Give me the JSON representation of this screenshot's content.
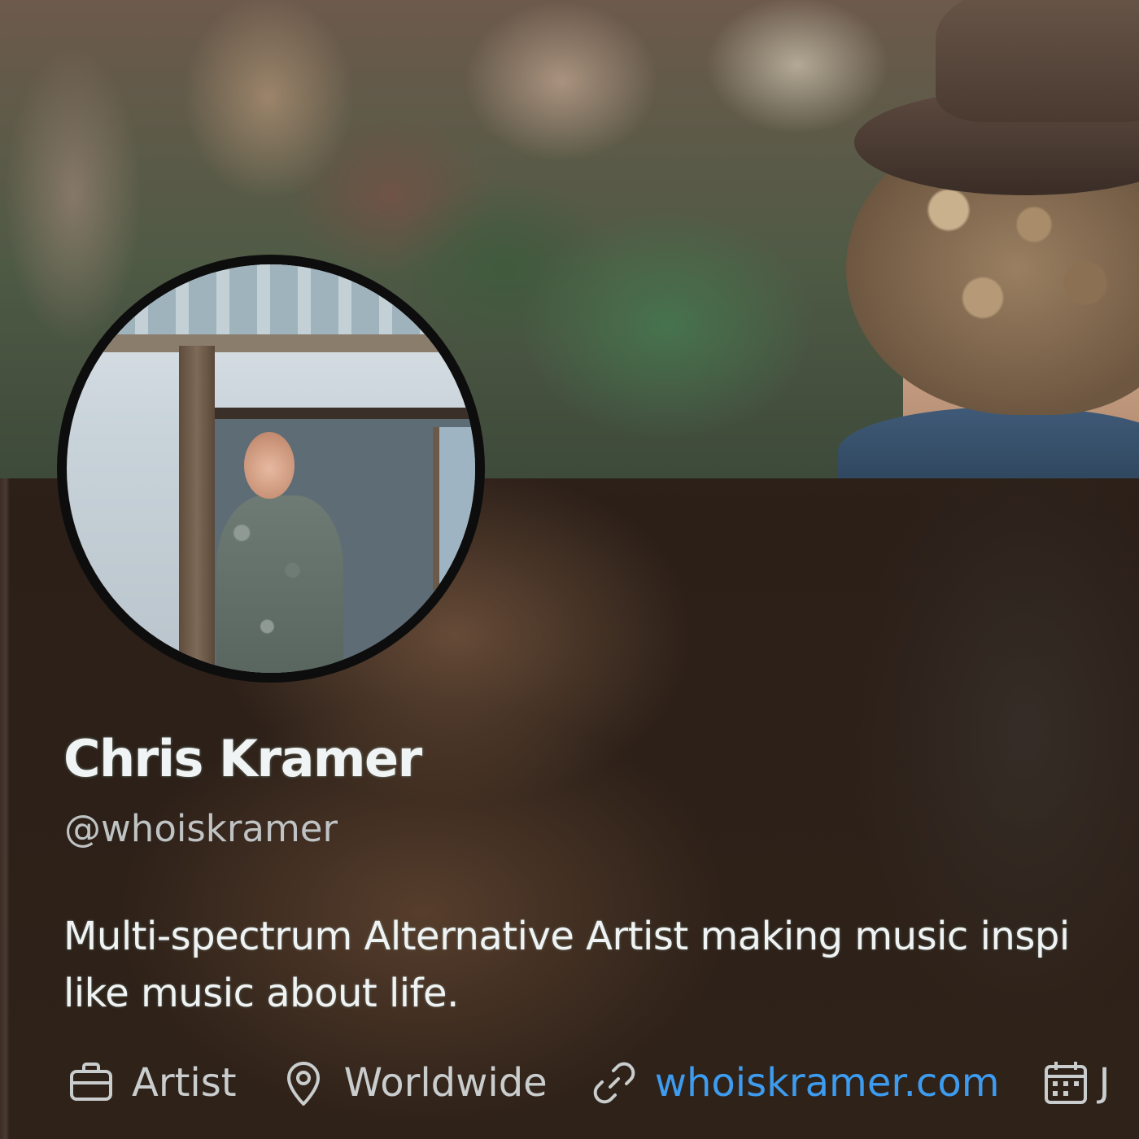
{
  "profile": {
    "display_name": "Chris Kramer",
    "handle": "@whoiskramer",
    "bio_lines": [
      "Multi-spectrum Alternative Artist making music inspi",
      "like music about life."
    ],
    "meta": {
      "profession": "Artist",
      "location": "Worldwide",
      "website": "whoiskramer.com",
      "joined_cut": "J"
    }
  },
  "icons": {
    "profession": "briefcase-icon",
    "location": "location-pin-icon",
    "website": "link-icon",
    "joined": "calendar-icon"
  },
  "colors": {
    "link": "#3d9cf0",
    "name_text": "#f1f4f4",
    "secondary_text": "#bfc3c4"
  }
}
